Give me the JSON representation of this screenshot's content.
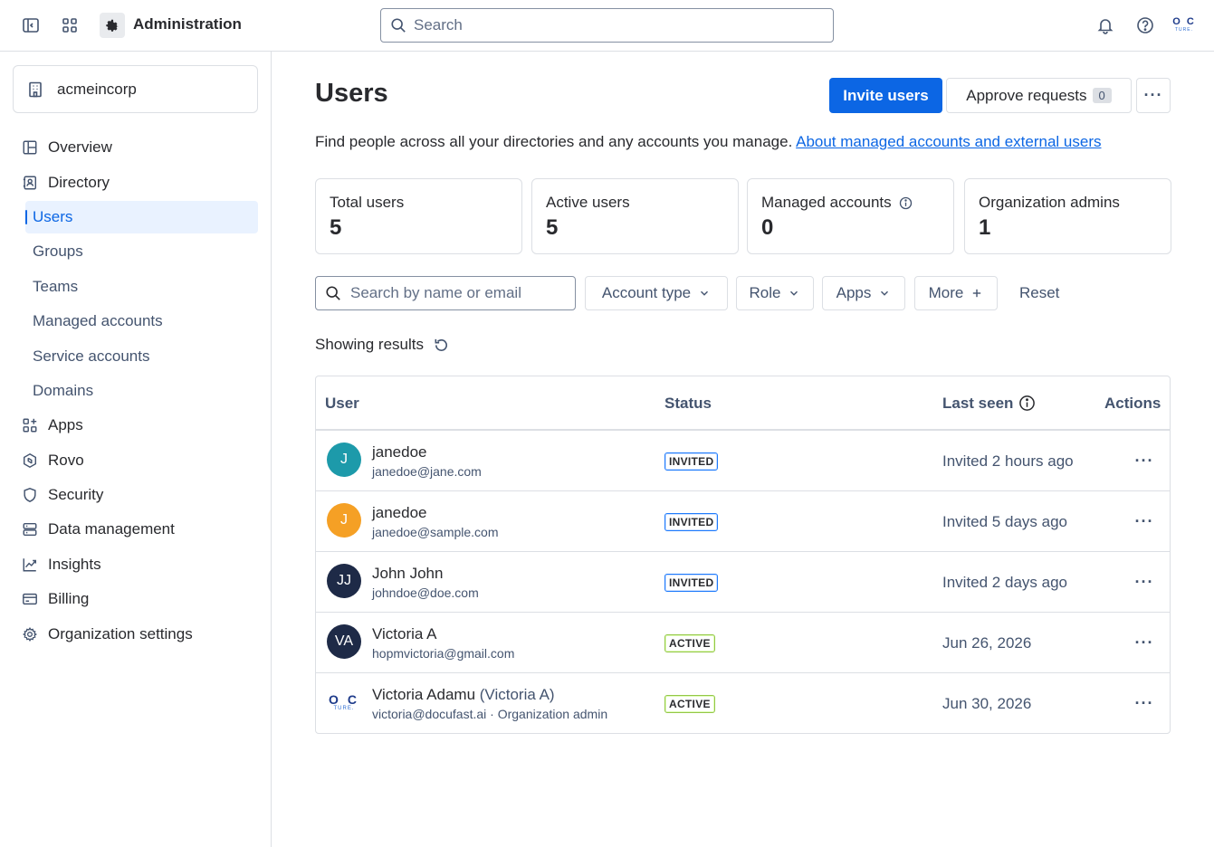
{
  "topbar": {
    "title": "Administration",
    "search_placeholder": "Search",
    "logo_line1": "O C",
    "logo_line2": "TURE.",
    "icons": [
      "sidebar-toggle-icon",
      "app-switcher-icon",
      "gear-icon",
      "search-icon",
      "bell-icon",
      "help-icon"
    ]
  },
  "sidebar": {
    "org_name": "acmeincorp",
    "items": [
      {
        "label": "Overview",
        "icon": "overview-icon"
      },
      {
        "label": "Directory",
        "icon": "directory-icon"
      },
      {
        "label": "Apps",
        "icon": "apps-icon"
      },
      {
        "label": "Rovo",
        "icon": "rovo-icon"
      },
      {
        "label": "Security",
        "icon": "shield-icon"
      },
      {
        "label": "Data management",
        "icon": "database-icon"
      },
      {
        "label": "Insights",
        "icon": "chart-line-icon"
      },
      {
        "label": "Billing",
        "icon": "credit-card-icon"
      },
      {
        "label": "Organization settings",
        "icon": "gear-icon"
      }
    ],
    "directory_sub": [
      {
        "label": "Users",
        "active": true
      },
      {
        "label": "Groups"
      },
      {
        "label": "Teams"
      },
      {
        "label": "Managed accounts"
      },
      {
        "label": "Service accounts"
      },
      {
        "label": "Domains"
      }
    ]
  },
  "main": {
    "title": "Users",
    "invite_label": "Invite users",
    "approve_label": "Approve requests",
    "approve_count": "0",
    "more_label": "···",
    "description": "Find people across all your directories and any accounts you manage.",
    "description_link": "About managed accounts and external users",
    "stats": [
      {
        "label": "Total users",
        "value": "5"
      },
      {
        "label": "Active users",
        "value": "5"
      },
      {
        "label": "Managed accounts",
        "value": "0"
      },
      {
        "label": "Organization admins",
        "value": "1"
      }
    ],
    "filters": {
      "search_placeholder": "Search by name or email",
      "account_type": "Account type",
      "role": "Role",
      "apps": "Apps",
      "more": "More",
      "reset": "Reset"
    },
    "showing": "Showing results",
    "table": {
      "headers": {
        "user": "User",
        "status": "Status",
        "last_seen": "Last seen",
        "actions": "Actions"
      },
      "rows": [
        {
          "initials": "J",
          "color": "#1d9aaa",
          "name": "janedoe",
          "alt": "",
          "email": "janedoe@jane.com",
          "status": "INVITED",
          "last_seen": "Invited 2 hours ago"
        },
        {
          "initials": "J",
          "color": "#f5a025",
          "name": "janedoe",
          "alt": "",
          "email": "janedoe@sample.com",
          "status": "INVITED",
          "last_seen": "Invited 5 days ago"
        },
        {
          "initials": "JJ",
          "color": "#1e2a47",
          "name": "John John",
          "alt": "",
          "email": "johndoe@doe.com",
          "status": "INVITED",
          "last_seen": "Invited 2 days ago"
        },
        {
          "initials": "VA",
          "color": "#1e2a47",
          "name": "Victoria A",
          "alt": "",
          "email": "hopmvictoria@gmail.com",
          "status": "ACTIVE",
          "last_seen": "Jun 26, 2026"
        },
        {
          "initials": "",
          "color": "#ffffff",
          "name": "Victoria Adamu",
          "alt": "(Victoria A)",
          "email": "victoria@docufast.ai · Organization admin",
          "status": "ACTIVE",
          "last_seen": "Jun 30, 2026"
        }
      ]
    }
  }
}
